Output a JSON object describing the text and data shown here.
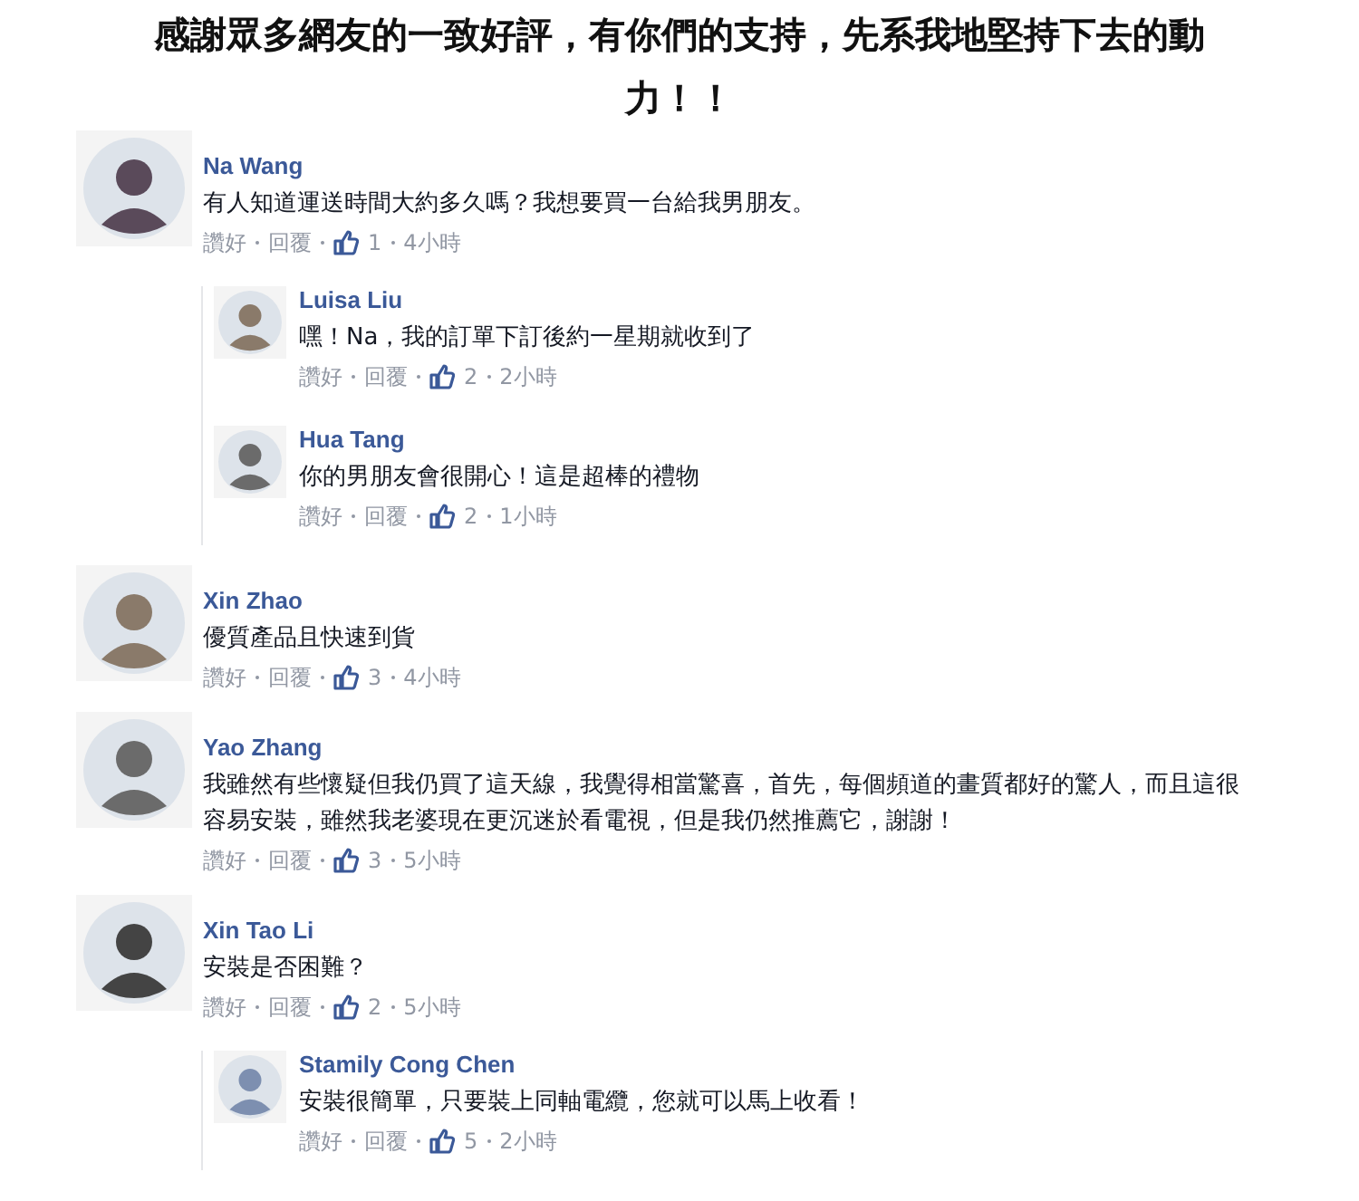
{
  "heading": "感謝眾多網友的一致好評，有你們的支持，先系我地堅持下去的動力！！",
  "comments": [
    {
      "author": "Na Wang",
      "text": "有人知道運送時間大約多久嗎？我想要買一台給我男朋友。",
      "like": "讚好",
      "reply": "回覆",
      "likes": "1",
      "time": "4小時",
      "children": [
        {
          "author": "Luisa Liu",
          "text": "嘿！Na，我的訂單下訂後約一星期就收到了",
          "like": "讚好",
          "reply": "回覆",
          "likes": "2",
          "time": "2小時"
        },
        {
          "author": "Hua Tang",
          "text": "你的男朋友會很開心！這是超棒的禮物",
          "like": "讚好",
          "reply": "回覆",
          "likes": "2",
          "time": "1小時"
        }
      ]
    },
    {
      "author": "Xin Zhao",
      "text": "優質產品且快速到貨",
      "like": "讚好",
      "reply": "回覆",
      "likes": "3",
      "time": "4小時"
    },
    {
      "author": "Yao Zhang",
      "text": "我雖然有些懷疑但我仍買了這天線，我覺得相當驚喜，首先，每個頻道的畫質都好的驚人，而且這很容易安裝，雖然我老婆現在更沉迷於看電視，但是我仍然推薦它，謝謝！",
      "like": "讚好",
      "reply": "回覆",
      "likes": "3",
      "time": "5小時"
    },
    {
      "author": "Xin Tao Li",
      "text": "安裝是否困難？",
      "like": "讚好",
      "reply": "回覆",
      "likes": "2",
      "time": "5小時",
      "children": [
        {
          "author": "Stamily Cong Chen",
          "text": "安裝很簡單，只要裝上同軸電纜，您就可以馬上收看！",
          "like": "讚好",
          "reply": "回覆",
          "likes": "5",
          "time": "2小時"
        }
      ]
    }
  ]
}
